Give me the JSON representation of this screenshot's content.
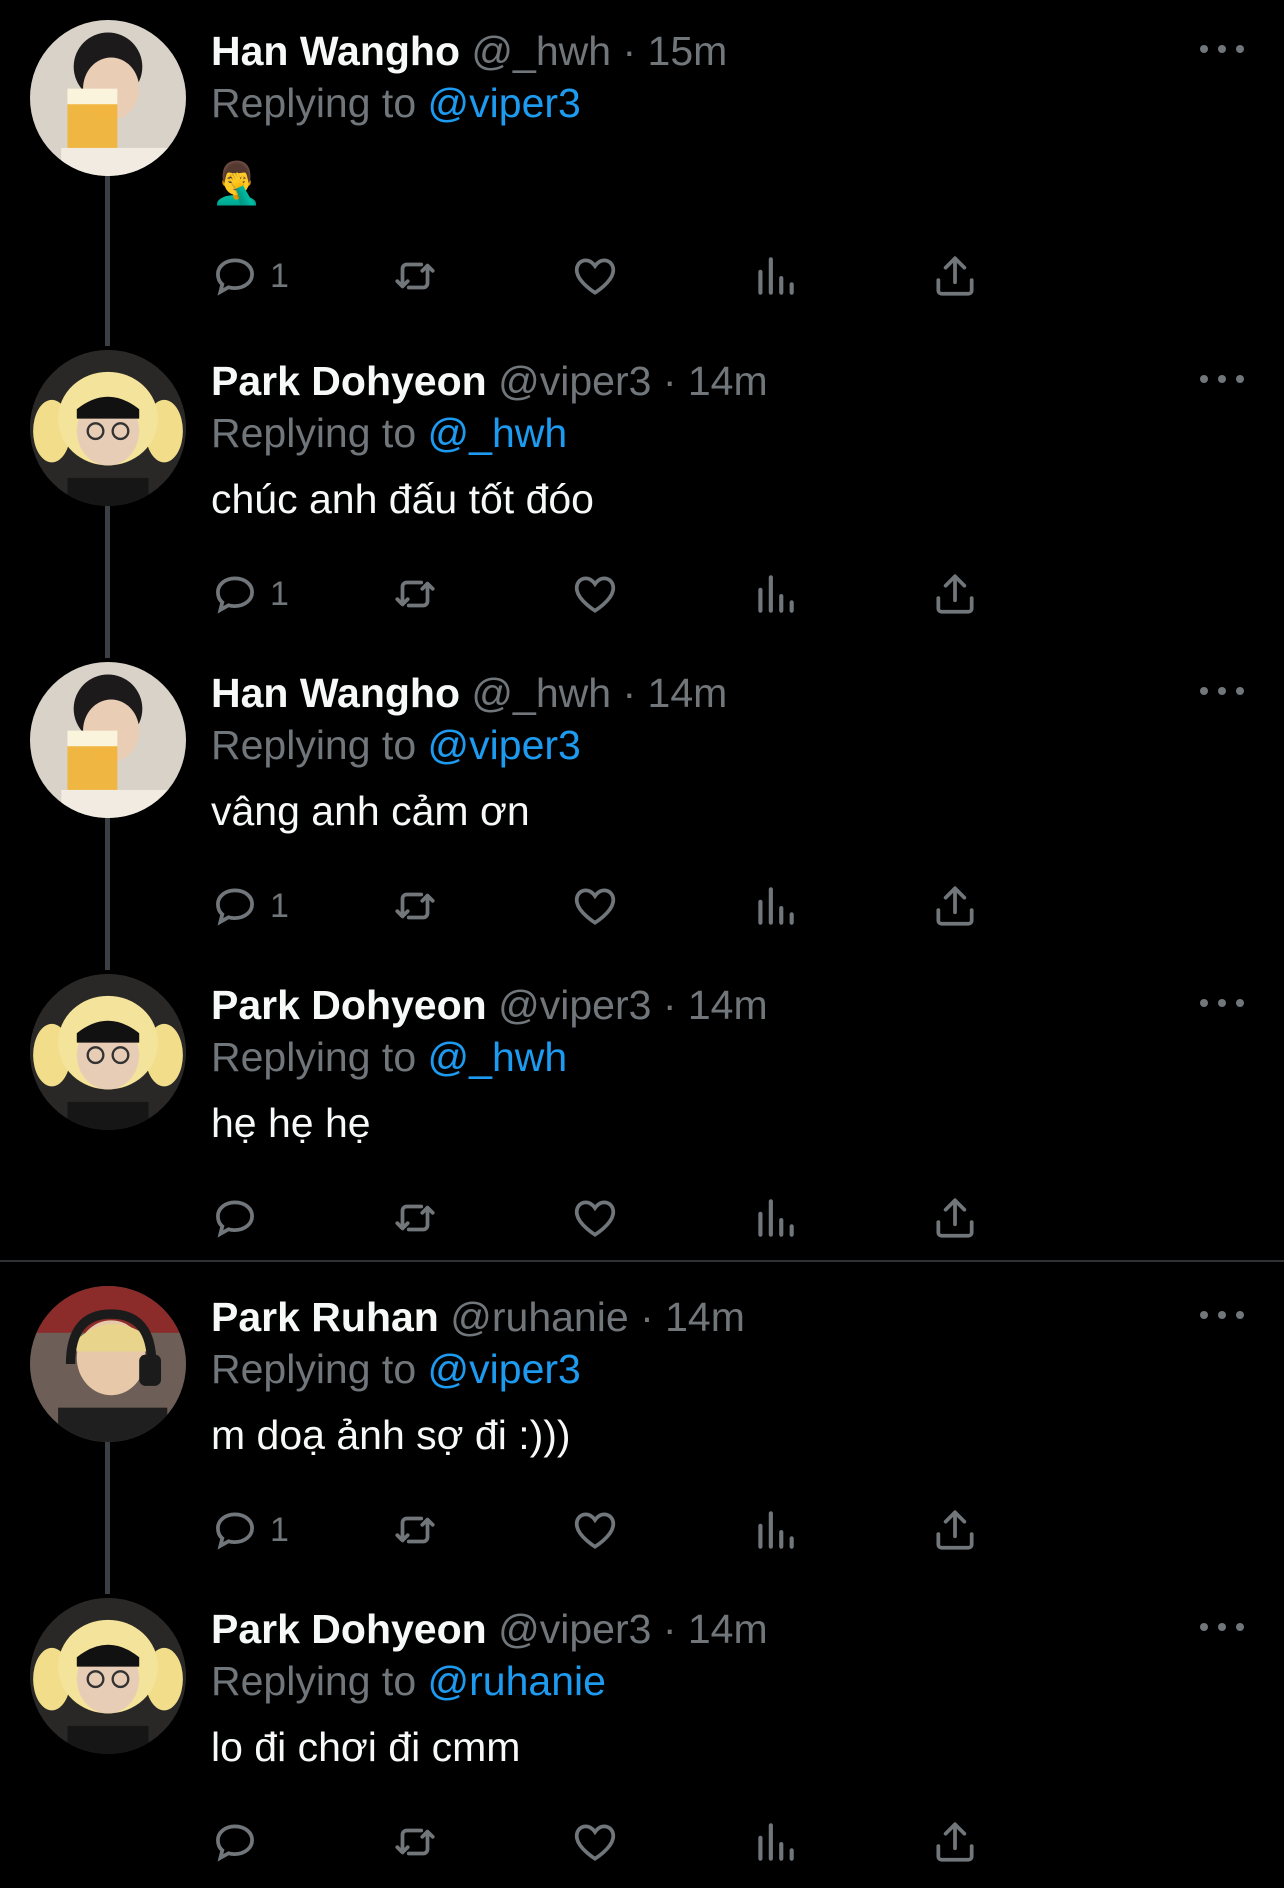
{
  "tweets": [
    {
      "name": "Han Wangho",
      "handle": "@_hwh",
      "dot": "·",
      "time": "15m",
      "reply_prefix": "Replying to",
      "reply_to": "@viper3",
      "text": "🤦‍♂️",
      "reply_count": "1",
      "avatar": "beer-guy"
    },
    {
      "name": "Park Dohyeon",
      "handle": "@viper3",
      "dot": "·",
      "time": "14m",
      "reply_prefix": "Replying to",
      "reply_to": "@_hwh",
      "text": "chúc anh đấu tốt đóo",
      "reply_count": "1",
      "avatar": "yellow-hat"
    },
    {
      "name": "Han Wangho",
      "handle": "@_hwh",
      "dot": "·",
      "time": "14m",
      "reply_prefix": "Replying to",
      "reply_to": "@viper3",
      "text": "vâng anh cảm ơn",
      "reply_count": "1",
      "avatar": "beer-guy"
    },
    {
      "name": "Park Dohyeon",
      "handle": "@viper3",
      "dot": "·",
      "time": "14m",
      "reply_prefix": "Replying to",
      "reply_to": "@_hwh",
      "text": "hẹ hẹ hẹ",
      "reply_count": "",
      "avatar": "yellow-hat"
    },
    {
      "name": "Park Ruhan",
      "handle": "@ruhanie",
      "dot": "·",
      "time": "14m",
      "reply_prefix": "Replying to",
      "reply_to": "@viper3",
      "text": "m doạ ảnh sợ đi :)))",
      "reply_count": "1",
      "avatar": "headset-guy"
    },
    {
      "name": "Park Dohyeon",
      "handle": "@viper3",
      "dot": "·",
      "time": "14m",
      "reply_prefix": "Replying to",
      "reply_to": "@ruhanie",
      "text": "lo đi chơi đi cmm",
      "reply_count": "",
      "avatar": "yellow-hat"
    }
  ],
  "colors": {
    "background": "#000000",
    "text": "#f7f9f9",
    "muted": "#71767b",
    "mention": "#1d9bf0",
    "thread_line": "#3b4046"
  }
}
